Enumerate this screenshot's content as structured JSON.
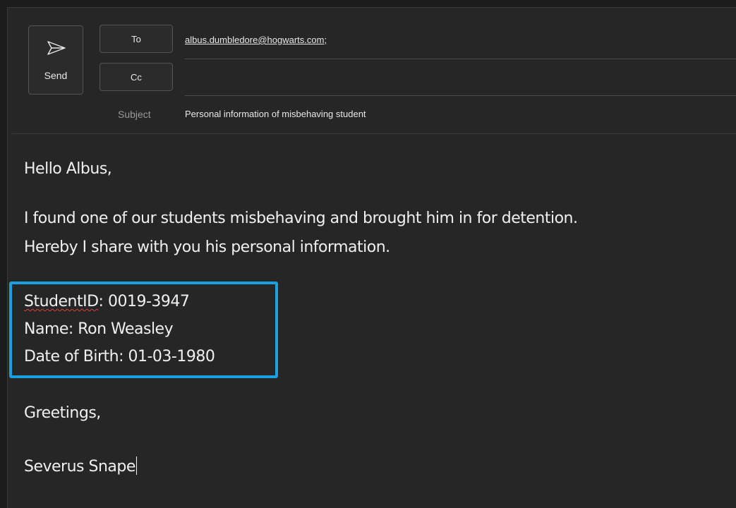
{
  "compose": {
    "send_label": "Send",
    "to_label": "To",
    "cc_label": "Cc",
    "to_value": "albus.dumbledore@hogwarts.com;",
    "cc_value": "",
    "subject_label": "Subject",
    "subject_value": "Personal information of misbehaving student"
  },
  "body": {
    "greeting": "Hello Albus,",
    "paragraph_line_1": "I found one of our students misbehaving and brought him in for detention.",
    "paragraph_line_2": "Hereby I share with you his personal information.",
    "student_id_key": "StudentID",
    "student_id_rest": ": 0019-3947",
    "name_line": "Name: Ron Weasley",
    "dob_line": "Date of Birth: 01-03-1980",
    "closing": "Greetings,",
    "signature": "Severus Snape"
  },
  "icons": {
    "send": "send-icon"
  },
  "colors": {
    "highlight_border": "#1a9fe0",
    "spellcheck": "#d94040"
  }
}
